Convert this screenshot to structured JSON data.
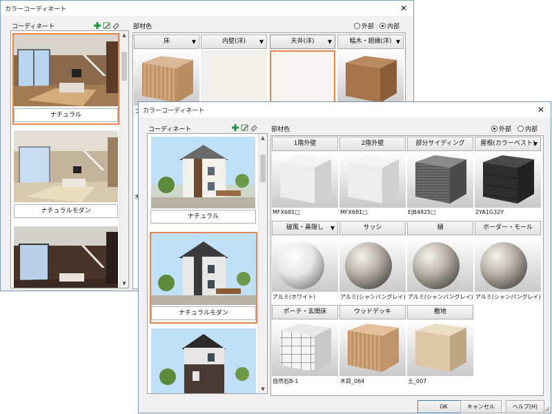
{
  "back_window": {
    "title": "カラーコーディネート",
    "coordinate_label": "コーディネート",
    "parts_label": "部材色",
    "radio_exterior": "外部",
    "radio_interior": "内部",
    "selected_radio": "interior",
    "coordinates": [
      "ナチュラル",
      "ナチュラルモダン"
    ],
    "headers": [
      "床",
      "内壁(洋)",
      "天井(洋)",
      "幅木・廻縁(洋)"
    ],
    "partial_text_1": "フロ",
    "partial_text_2": "木"
  },
  "front_window": {
    "title": "カラーコーディネート",
    "coordinate_label": "コーディネート",
    "parts_label": "部材色",
    "radio_exterior": "外部",
    "radio_interior": "内部",
    "selected_radio": "exterior",
    "coordinates": [
      "ナチュラル",
      "ナチュラルモダン"
    ],
    "materials_row1": [
      {
        "header": "1階外壁",
        "code": "MFX681□",
        "dropdown": false
      },
      {
        "header": "2階外壁",
        "code": "MFX681□",
        "dropdown": false
      },
      {
        "header": "部分サイディング",
        "code": "EJB4825□",
        "dropdown": false
      },
      {
        "header": "屋根(カラーベスト)",
        "code": "2YA1G32Y",
        "dropdown": true
      }
    ],
    "materials_row2": [
      {
        "header": "破風・鼻隠し",
        "code": "アルミ(ホワイト)",
        "dropdown": true
      },
      {
        "header": "サッシ",
        "code": "アルミ(シャンパングレイ)",
        "dropdown": false
      },
      {
        "header": "樋",
        "code": "アルミ(シャンパングレイ)",
        "dropdown": false
      },
      {
        "header": "ボーダー・モール",
        "code": "アルミ(シャンパングレイ)",
        "dropdown": false
      }
    ],
    "materials_row3": [
      {
        "header": "ポーチ・玄関床",
        "code": "自然石B-1",
        "dropdown": false
      },
      {
        "header": "ウッドデッキ",
        "code": "木目_064",
        "dropdown": false
      },
      {
        "header": "敷地",
        "code": "土_007",
        "dropdown": false
      }
    ],
    "ok_label": "OK",
    "cancel_label": "キャンセル",
    "help_label": "ヘルプ(H)"
  },
  "colors": {
    "selection": "#e8834a",
    "window_bg": "#f0f0f0",
    "add_icon": "#1a9a3c"
  }
}
